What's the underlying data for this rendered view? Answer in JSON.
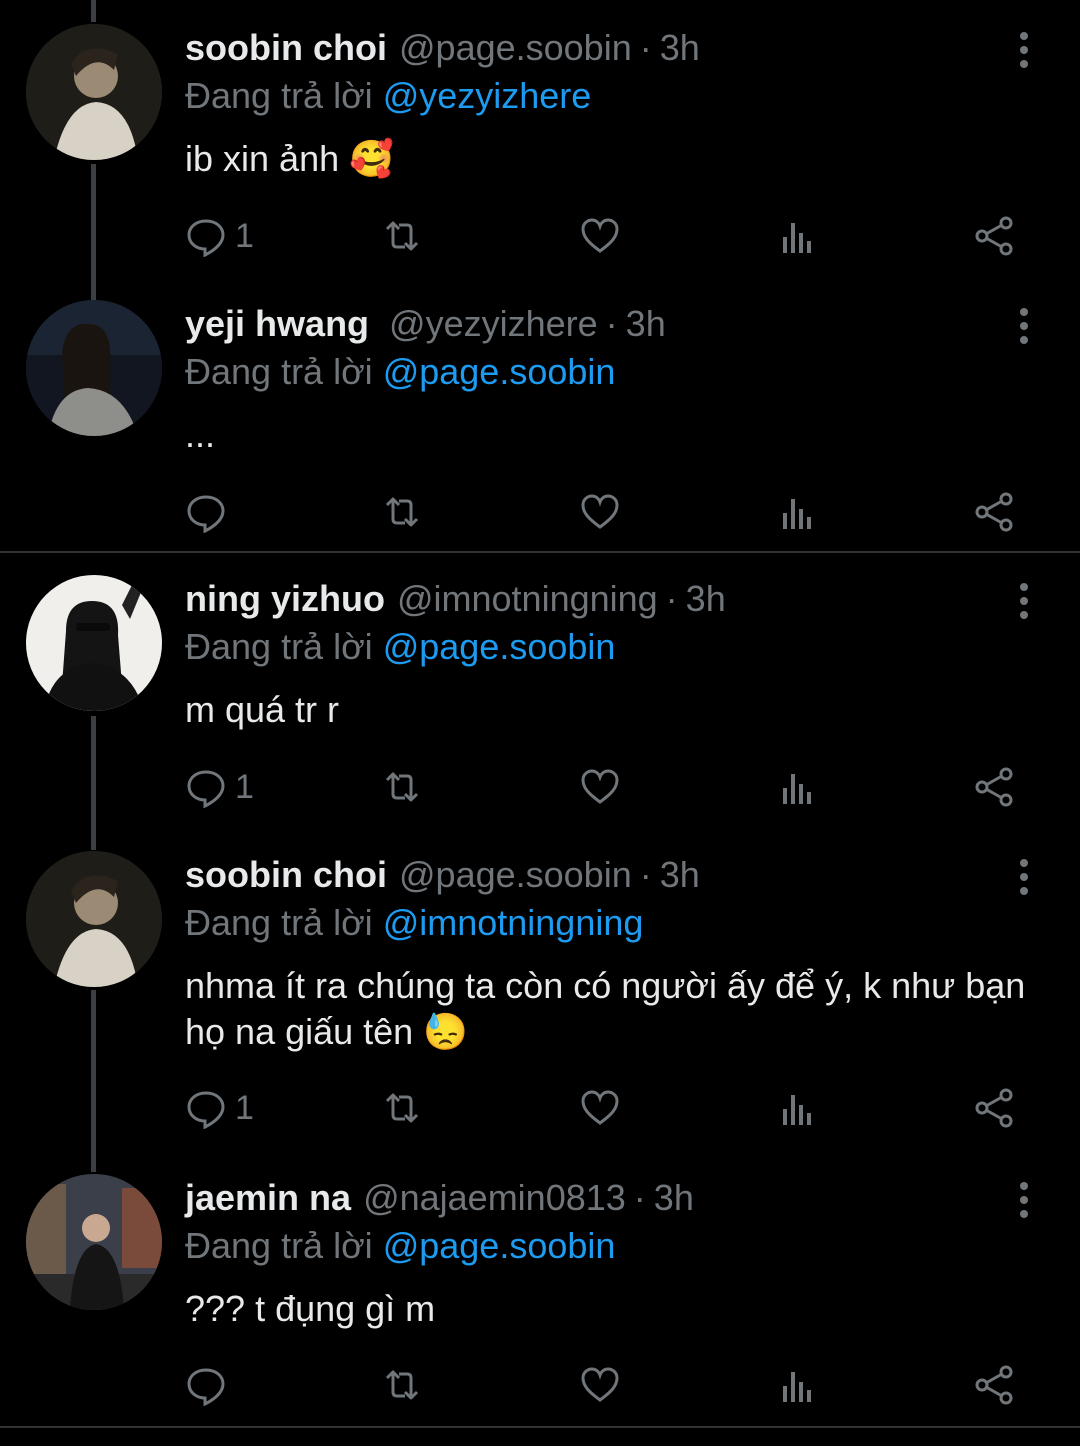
{
  "colors": {
    "background": "#000000",
    "name": "#e7e9ea",
    "muted": "#71767b",
    "mention": "#1d9bf0",
    "line": "#2f3336"
  },
  "icons": [
    "reply-icon",
    "retweet-icon",
    "like-icon",
    "views-icon",
    "share-icon",
    "more-icon"
  ],
  "tweets": [
    {
      "name": "soobin choi",
      "handle": "@page.soobin",
      "time": "3h",
      "reply_prefix": "Đang trả lời",
      "reply_to": "@yezyizhere",
      "text": "ib xin ảnh 🥰",
      "reply_count": "1"
    },
    {
      "name": "yeji hwang",
      "handle": "@yezyizhere",
      "time": "3h",
      "reply_prefix": "Đang trả lời",
      "reply_to": "@page.soobin",
      "text": "...",
      "reply_count": ""
    },
    {
      "name": "ning yizhuo",
      "handle": "@imnotningning",
      "time": "3h",
      "reply_prefix": "Đang trả lời",
      "reply_to": "@page.soobin",
      "text": "m quá tr r",
      "reply_count": "1"
    },
    {
      "name": "soobin choi",
      "handle": "@page.soobin",
      "time": "3h",
      "reply_prefix": "Đang trả lời",
      "reply_to": "@imnotningning",
      "text": "nhma ít ra chúng ta còn có người ấy để ý, k như bạn họ na giấu tên 😓",
      "reply_count": "1"
    },
    {
      "name": "jaemin na",
      "handle": "@najaemin0813",
      "time": "3h",
      "reply_prefix": "Đang trả lời",
      "reply_to": "@page.soobin",
      "text": "??? t đụng gì m",
      "reply_count": ""
    }
  ]
}
